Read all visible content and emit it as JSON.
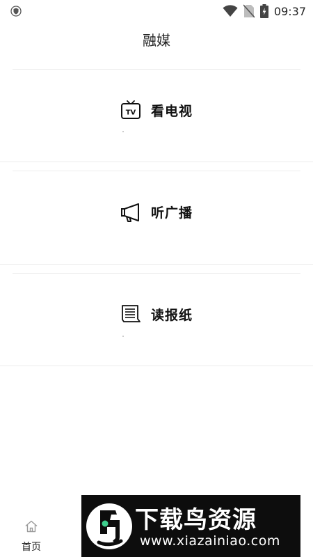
{
  "status_bar": {
    "time": "09:37",
    "icons": [
      "shield-icon",
      "wifi-icon",
      "no-sim-icon",
      "battery-charging-icon"
    ]
  },
  "header": {
    "title": "融媒"
  },
  "cards": [
    {
      "label": "看电视",
      "icon": "tv-icon"
    },
    {
      "label": "听广播",
      "icon": "megaphone-icon"
    },
    {
      "label": "读报纸",
      "icon": "newspaper-icon"
    }
  ],
  "tabbar": {
    "items": [
      {
        "label": "首页",
        "icon": "home-icon",
        "active": true
      }
    ]
  },
  "watermark": {
    "title": "下载鸟资源",
    "url": "www.xiazainiao.com",
    "logo": "bird-logo-icon"
  },
  "colors": {
    "background": "#ffffff",
    "text": "#222222",
    "divider": "#ececec",
    "watermark_bg": "#0d0d0d",
    "logo_accent": "#3ecf8e"
  }
}
